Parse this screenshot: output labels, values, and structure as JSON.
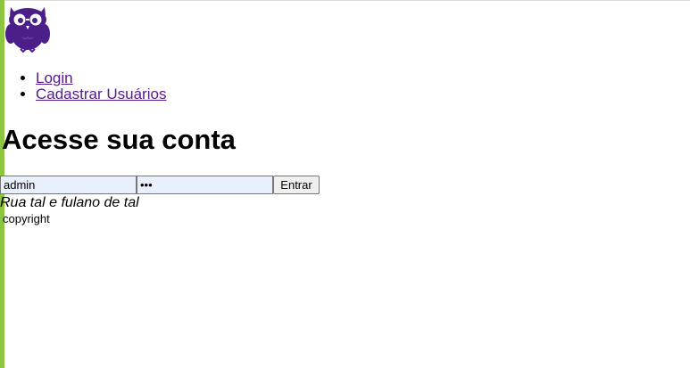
{
  "brand": {
    "logo_icon": "owl-logo-icon",
    "logo_color": "#4b1e8a",
    "accent_bar_color": "#8cc63f"
  },
  "nav": {
    "items": [
      {
        "label": "Login"
      },
      {
        "label": "Cadastrar Usuários"
      }
    ]
  },
  "main": {
    "title": "Acesse sua conta",
    "form": {
      "username_value": "admin",
      "password_value": "•••",
      "submit_label": "Entrar"
    }
  },
  "footer": {
    "address": "Rua tal e fulano de tal",
    "copyright": "copyright"
  }
}
